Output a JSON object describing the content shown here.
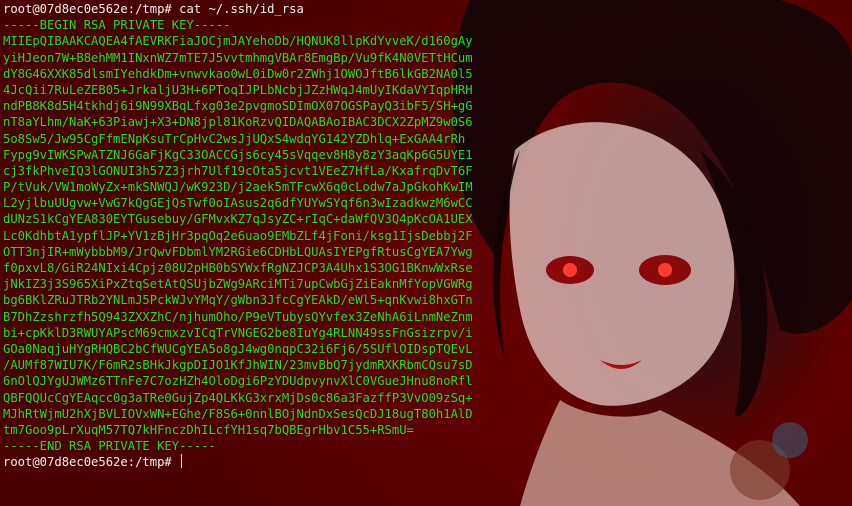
{
  "terminal": {
    "command_prompt": "root@07d8ec0e562e:/tmp#",
    "command": "cat ~/.ssh/id_rsa",
    "key_header": "-----BEGIN RSA PRIVATE KEY-----",
    "key_body": [
      "MIIEpQIBAAKCAQEA4fAEVRKFiaJOCjmJAYehoDb/HQNUK8llpKdYvveK/d160gAy",
      "yiHJeon7W+B8ehMM1INxnWZ7mTE7J5vvtmhmgVBAr8EmgBp/Vu9fK4N0VETtHCum",
      "dY8G46XXK85dlsmIYehdkDm+vnwvkao0wL0iDw0r2ZWhj1OWOJftB6lkGB2NA0l5",
      "4JcQii7RuLeZEB05+JrkaljU3H+6PToqIJPLbNcbjJZzHWqJ4mUyIKdaVYIqpHRH",
      "ndPB8K8d5H4tkhdj6i9N99XBqLfxg03e2pvgmoSDImOX07OGSPayQ3ibF5/SH+gG",
      "nT8aYLhm/NaK+63Piawj+X3+DN8jpl81KoRzvQIDAQABAoIBAC3DCX2ZpMZ9w0S6",
      "5o8Sw5/Jw95CgFfmENpKsuTrCpHvC2wsJjUQxS4wdqYG142YZDhlq+ExGAA4rRh",
      "Fypg9vIWKSPwATZNJ6GaFjKgC33OACCGjs6cy45sVqqev8H8y8zY3aqKp6G5UYE1",
      "cj3fkPhveIQ3lGONUI3h57Z3jrh7Ulf19cOta5jcvt1VEeZ7HfLa/KxafrqDvT6F",
      "P/tVuk/VW1moWyZx+mkSNWQJ/wK923D/j2aek5mTFcwX6q0cLodw7aJpGkohKwIM",
      "L2yjlbuUUgvw+VwG7kQgGEjQsTwf0oIAsus2q6dfYUYwSYqf6n3wIzadkwzM6wCC",
      "dUNzS1kCgYEA830EYTGusebuy/GFMvxKZ7qJsyZC+rIqC+daWfQV3Q4pKcOA1UEX",
      "Lc0KdhbtA1ypflJP+YV1zBjHr3pqOq2e6uao9EMbZLf4jFoni/ksg1IjsDebbj2F",
      "OTT3njIR+mWybbbM9/JrQwvFDbmlYM2RGie6CDHbLQUAsIYEPgfRtusCgYEA7Ywg",
      "f0pxvL8/GiR24NIxi4Cpjz08U2pHB0bSYWxfRgNZJCP3A4Uhx1S3OG1BKnwWxRse",
      "jNkIZ3j3S965XiPxZtqSetAtQSUjbZWg9ARciMTi7upCwbGjZiEaknMfYopVGWRg",
      "bg6BKlZRuJTRb2YNLmJ5PckWJvYMqY/gWbn3JfcCgYEAkD/eWl5+qnKvwi8hxGTn",
      "B7DhZzshrzfh5Q943ZXXZhC/njhumOho/P9eVTubysQYvfex3ZeNhA6iLnmNeZnm",
      "bi+cpKklD3RWUYAPscM69cmxzvICqTrVNGEG2be8IuYg4RLNN49ssFnGsizrpv/i",
      "GOa0NaqjuHYgRHQBC2bCfWUCgYEA5o8gJ4wg0nqpC32i6Fj6/5SUflOIDspTQEvL",
      "/AUMf87WIU7K/F6mR2sBHkJkgpDIJO1KfJhWIN/23mvBbQ7jydmRXKRbmCQsu7sD",
      "6nOlQJYgUJWMz6TTnFe7C7ozHZh4OloDgi6PzYDUdpvynvXlC0VGueJHnu8noRfl",
      "QBFQQUcCgYEAqcc0g3aTRe0GujZp4QLKkG3xrxMjDs0c86a3FazffP3VvO09zSq+",
      "MJhRtWjmU2hXjBVLIOVxWN+EGhe/F8S6+0nnlBOjNdnDxSesQcDJ18ugT80h1AlD",
      "tm7Goo9pLrXuqM57TQ7kHFnczDhILcfYH1sq7bQBEgrHbv1C55+RSmU="
    ],
    "key_footer": "-----END RSA PRIVATE KEY-----",
    "final_prompt": "root@07d8ec0e562e:/tmp#",
    "colors": {
      "background": "#5a0000",
      "prompt": "#f2f2f2",
      "key_text": "#22dd22"
    }
  }
}
